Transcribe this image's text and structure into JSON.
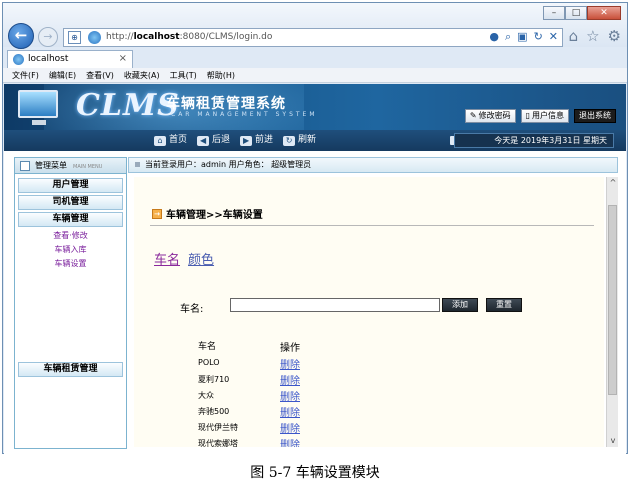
{
  "browser": {
    "url_prefix": "http://",
    "url_host": "localhost",
    "url_rest": ":8080/CLMS/login.do",
    "tab_label": "localhost",
    "tab_close": "×",
    "menu": [
      "文件(F)",
      "编辑(E)",
      "查看(V)",
      "收藏夹(A)",
      "工具(T)",
      "帮助(H)"
    ],
    "window_buttons": [
      "–",
      "□",
      "✕"
    ]
  },
  "app": {
    "logo": "CLMS",
    "title": "车辆租赁管理系统",
    "subtitle": "CAR MANAGEMENT SYSTEM",
    "top_buttons": {
      "change_password": "修改密码",
      "user_info": "用户信息",
      "exit": "退出系统"
    },
    "nav": {
      "home": "首页",
      "back": "后退",
      "forward": "前进",
      "refresh": "刷新"
    },
    "date": "今天是  2019年3月31日  星期天"
  },
  "sidebar": {
    "header": "管理菜单",
    "header_en": "MAIN MENU",
    "categories": [
      "用户管理",
      "司机管理",
      "车辆管理",
      "车辆租赁管理"
    ],
    "vehicle_items": [
      "查看·修改",
      "车辆入库",
      "车辆设置"
    ]
  },
  "userbar": {
    "text": "当前登录用户：admin  用户角色：  超级管理员"
  },
  "main": {
    "breadcrumb": "车辆管理>>车辆设置",
    "tabs": [
      "车名",
      "颜色"
    ],
    "form": {
      "label": "车名:",
      "input_value": "",
      "add_button": "添加",
      "reset_button": "重置"
    },
    "table": {
      "headers": [
        "车名",
        "操作"
      ],
      "rows": [
        {
          "name": "POLO",
          "action": "删除"
        },
        {
          "name": "夏利710",
          "action": "删除"
        },
        {
          "name": "大众",
          "action": "删除"
        },
        {
          "name": "奔驰500",
          "action": "删除"
        },
        {
          "name": "现代伊兰特",
          "action": "删除"
        },
        {
          "name": "现代索娜塔",
          "action": "删除"
        }
      ]
    }
  },
  "caption": "图 5-7  车辆设置模块"
}
